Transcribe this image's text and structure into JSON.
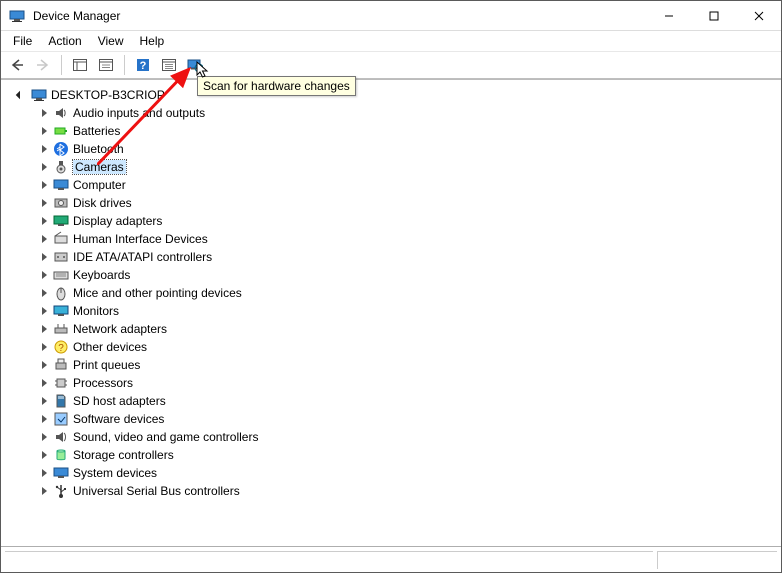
{
  "window": {
    "title": "Device Manager"
  },
  "menu": {
    "file": "File",
    "action": "Action",
    "view": "View",
    "help": "Help"
  },
  "tooltip": {
    "scan": "Scan for hardware changes"
  },
  "tree": {
    "root": "DESKTOP-B3CRIOP",
    "items": [
      {
        "label": "Audio inputs and outputs",
        "icon": "audio"
      },
      {
        "label": "Batteries",
        "icon": "battery"
      },
      {
        "label": "Bluetooth",
        "icon": "bluetooth"
      },
      {
        "label": "Cameras",
        "icon": "camera",
        "selected": true
      },
      {
        "label": "Computer",
        "icon": "computer"
      },
      {
        "label": "Disk drives",
        "icon": "disk"
      },
      {
        "label": "Display adapters",
        "icon": "display"
      },
      {
        "label": "Human Interface Devices",
        "icon": "hid"
      },
      {
        "label": "IDE ATA/ATAPI controllers",
        "icon": "ide"
      },
      {
        "label": "Keyboards",
        "icon": "keyboard"
      },
      {
        "label": "Mice and other pointing devices",
        "icon": "mouse"
      },
      {
        "label": "Monitors",
        "icon": "monitor"
      },
      {
        "label": "Network adapters",
        "icon": "network"
      },
      {
        "label": "Other devices",
        "icon": "other"
      },
      {
        "label": "Print queues",
        "icon": "printer"
      },
      {
        "label": "Processors",
        "icon": "cpu"
      },
      {
        "label": "SD host adapters",
        "icon": "sd"
      },
      {
        "label": "Software devices",
        "icon": "software"
      },
      {
        "label": "Sound, video and game controllers",
        "icon": "sound"
      },
      {
        "label": "Storage controllers",
        "icon": "storage"
      },
      {
        "label": "System devices",
        "icon": "system"
      },
      {
        "label": "Universal Serial Bus controllers",
        "icon": "usb"
      }
    ]
  }
}
